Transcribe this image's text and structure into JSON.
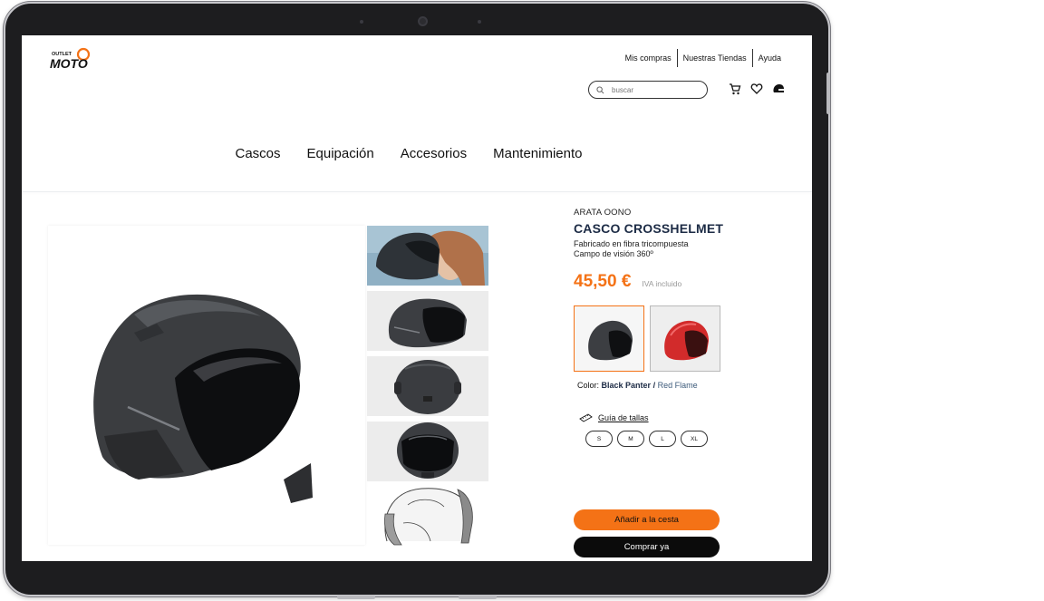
{
  "header": {
    "logo_small": "OUTLET",
    "logo_big": "MOTO",
    "links": [
      "Mis compras",
      "Nuestras Tiendas",
      "Ayuda"
    ],
    "search_placeholder": "buscar"
  },
  "nav": [
    "Cascos",
    "Equipación",
    "Accesorios",
    "Mantenimiento"
  ],
  "product": {
    "brand": "ARATA OONO",
    "name": "CASCO CROSSHELMET",
    "desc_line1": "Fabricado en fibra tricompuesta",
    "desc_line2": "Campo de visión 360º",
    "price": "45,50 €",
    "iva": "IVA incluido",
    "color_label": "Color:",
    "color_selected": "Black Panter",
    "color_separator": "/",
    "color_other": "Red Flame",
    "size_guide": "Guía de tallas",
    "sizes": [
      "S",
      "M",
      "L",
      "XL"
    ],
    "add_to_cart": "Añadir a la cesta",
    "buy_now": "Comprar ya"
  },
  "colors": {
    "accent": "#f47216",
    "dark_blue": "#1c2b45",
    "black": "#0b0b0b"
  }
}
